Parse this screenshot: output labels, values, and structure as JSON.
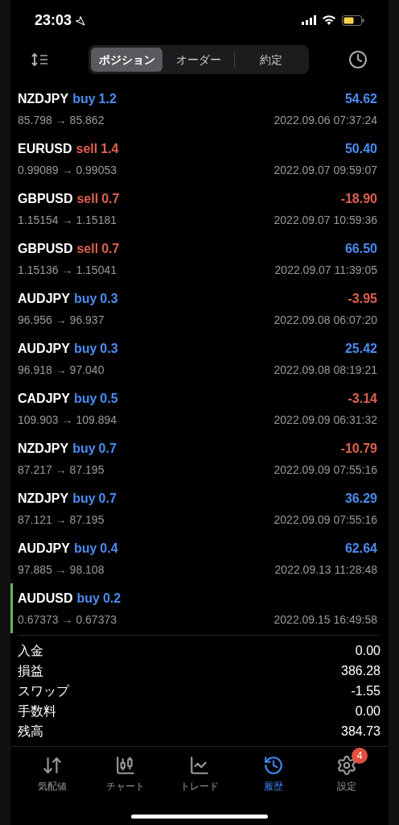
{
  "status_bar": {
    "time": "23:03"
  },
  "segments": [
    {
      "label": "ポジション",
      "selected": true
    },
    {
      "label": "オーダー",
      "selected": false
    },
    {
      "label": "約定",
      "selected": false
    }
  ],
  "trades": [
    {
      "symbol": "NZDJPY",
      "kind": "buy",
      "side": "buy",
      "volume": "1.2",
      "profit": "54.62",
      "loss": false,
      "prices": "85.798 → 85.862",
      "time": "2022.09.06 07:37:24",
      "selected": false
    },
    {
      "symbol": "EURUSD",
      "kind": "sell",
      "side": "sell",
      "volume": "1.4",
      "profit": "50.40",
      "loss": false,
      "prices": "0.99089 → 0.99053",
      "time": "2022.09.07 09:59:07",
      "selected": false
    },
    {
      "symbol": "GBPUSD",
      "kind": "sell",
      "side": "sell",
      "volume": "0.7",
      "profit": "-18.90",
      "loss": true,
      "prices": "1.15154 → 1.15181",
      "time": "2022.09.07 10:59:36",
      "selected": false
    },
    {
      "symbol": "GBPUSD",
      "kind": "sell",
      "side": "sell",
      "volume": "0.7",
      "profit": "66.50",
      "loss": false,
      "prices": "1.15136 → 1.15041",
      "time": "2022.09.07 11:39:05",
      "selected": false
    },
    {
      "symbol": "AUDJPY",
      "kind": "buy",
      "side": "buy",
      "volume": "0.3",
      "profit": "-3.95",
      "loss": true,
      "prices": "96.956 → 96.937",
      "time": "2022.09.08 06:07:20",
      "selected": false
    },
    {
      "symbol": "AUDJPY",
      "kind": "buy",
      "side": "buy",
      "volume": "0.3",
      "profit": "25.42",
      "loss": false,
      "prices": "96.918 → 97.040",
      "time": "2022.09.08 08:19:21",
      "selected": false
    },
    {
      "symbol": "CADJPY",
      "kind": "buy",
      "side": "buy",
      "volume": "0.5",
      "profit": "-3.14",
      "loss": true,
      "prices": "109.903 → 109.894",
      "time": "2022.09.09 06:31:32",
      "selected": false
    },
    {
      "symbol": "NZDJPY",
      "kind": "buy",
      "side": "buy",
      "volume": "0.7",
      "profit": "-10.79",
      "loss": true,
      "prices": "87.217 → 87.195",
      "time": "2022.09.09 07:55:16",
      "selected": false
    },
    {
      "symbol": "NZDJPY",
      "kind": "buy",
      "side": "buy",
      "volume": "0.7",
      "profit": "36.29",
      "loss": false,
      "prices": "87.121 → 87.195",
      "time": "2022.09.09 07:55:16",
      "selected": false
    },
    {
      "symbol": "AUDJPY",
      "kind": "buy",
      "side": "buy",
      "volume": "0.4",
      "profit": "62.64",
      "loss": false,
      "prices": "97.885 → 98.108",
      "time": "2022.09.13 11:28:48",
      "selected": false
    },
    {
      "symbol": "AUDUSD",
      "kind": "buy",
      "side": "buy",
      "volume": "0.2",
      "prices": "0.67373 → 0.67373",
      "time": "2022.09.15 16:49:58",
      "selected": true
    }
  ],
  "summary": [
    {
      "label": "入金",
      "value": "0.00"
    },
    {
      "label": "損益",
      "value": "386.28"
    },
    {
      "label": "スワップ",
      "value": "-1.55"
    },
    {
      "label": "手数料",
      "value": "0.00"
    },
    {
      "label": "残高",
      "value": "384.73"
    }
  ],
  "tab_bar": [
    {
      "kind": "quotes",
      "label": "気配値",
      "selected": false
    },
    {
      "kind": "chart",
      "label": "チャート",
      "selected": false
    },
    {
      "kind": "trade",
      "label": "トレード",
      "selected": false
    },
    {
      "kind": "history",
      "label": "履歴",
      "selected": true
    },
    {
      "kind": "settings",
      "label": "設定",
      "selected": false,
      "badge": "4"
    }
  ]
}
